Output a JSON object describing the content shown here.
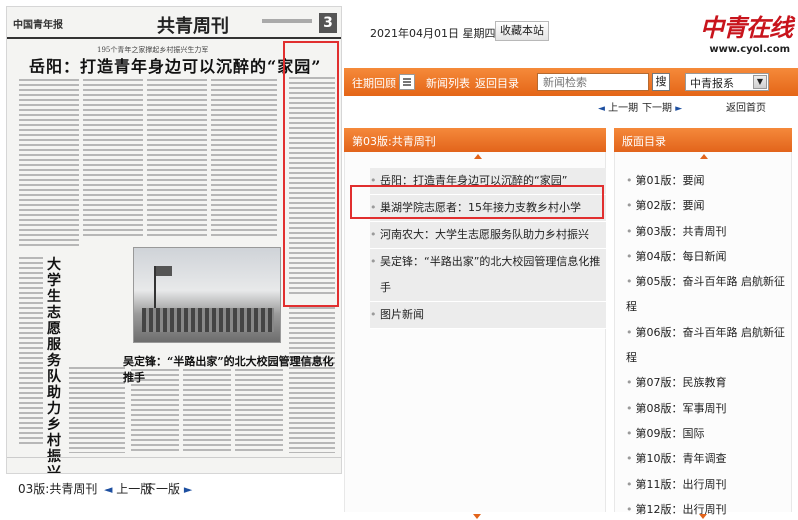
{
  "header": {
    "date": "2021年04月01日 星期四",
    "favorite_label": "收藏本站",
    "brand_mark": "中青在线",
    "brand_url": "www.cyol.com"
  },
  "toolbar": {
    "past_issues": "往期回顾",
    "news_list": "新闻列表",
    "back_to_index": "返回目录",
    "search_placeholder": "新闻检索",
    "search_button": "搜",
    "paper_select": "中青报系"
  },
  "pager": {
    "prev_page": "上一期",
    "next_page": "下一期",
    "back_home": "返回首页"
  },
  "newspaper": {
    "masthead_logo": "中国青年报",
    "section": "共青周刊",
    "page_number": "3",
    "kicker": "195个青年之家撑起乡村振兴生力军",
    "headline": "岳阳：打造青年身边可以沉醉的“家园”",
    "bottom_headline": "吴定锋：“半路出家”的北大校园管理信息化推手",
    "vertical_headline": "大学生志愿服务队助力乡村振兴"
  },
  "paper_nav": {
    "page_name": "03版:共青周刊",
    "prev": "上一版",
    "next": "下一版"
  },
  "articles_panel": {
    "title": "第03版:共青周刊",
    "items": [
      "岳阳：打造青年身边可以沉醉的“家园”",
      "巢湖学院志愿者：15年接力支教乡村小学",
      "河南农大：大学生志愿服务队助力乡村振兴",
      "吴定锋：“半路出家”的北大校园管理信息化推手",
      "图片新闻"
    ]
  },
  "pages_panel": {
    "title": "版面目录",
    "items": [
      "第01版：要闻",
      "第02版：要闻",
      "第03版：共青周刊",
      "第04版：每日新闻",
      "第05版：奋斗百年路 启航新征程",
      "第06版：奋斗百年路 启航新征程",
      "第07版：民族教育",
      "第08版：军事周刊",
      "第09版：国际",
      "第10版：青年调查",
      "第11版：出行周刊",
      "第12版：出行周刊"
    ]
  },
  "colors": {
    "accent_orange": "#e8721f",
    "brand_red": "#c8141c",
    "highlight_red": "#e12f2f",
    "link_blue": "#1d4fa0"
  }
}
